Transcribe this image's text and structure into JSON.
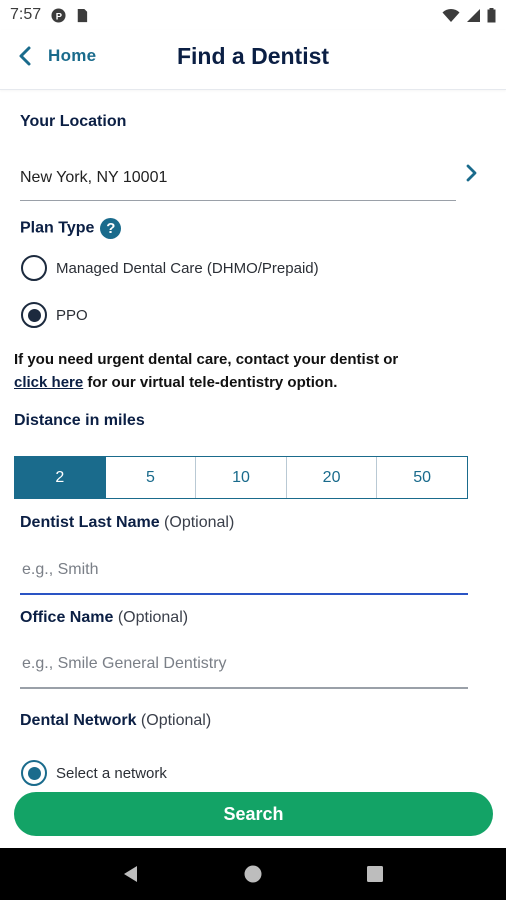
{
  "status_bar": {
    "time": "7:57",
    "left_icons": [
      "circle-p-icon",
      "sd-card-icon"
    ],
    "right_icons": [
      "wifi-icon",
      "signal-icon",
      "battery-icon"
    ]
  },
  "header": {
    "back_label": "Home",
    "title": "Find a Dentist"
  },
  "location": {
    "label": "Your Location",
    "value": "New York, NY 10001"
  },
  "plan_type": {
    "label": "Plan Type",
    "help_glyph": "?",
    "options": [
      {
        "label": "Managed Dental Care (DHMO/Prepaid)",
        "selected": false
      },
      {
        "label": "PPO",
        "selected": true
      }
    ]
  },
  "urgent": {
    "text_before": "If you need urgent dental care, contact your dentist or",
    "link": "click here",
    "text_after": "for our virtual tele-dentistry option."
  },
  "distance": {
    "label": "Distance in miles",
    "options": [
      "2",
      "5",
      "10",
      "20",
      "50"
    ],
    "selected": "2"
  },
  "dentist_last_name": {
    "label": "Dentist Last Name",
    "optional": "(Optional)",
    "placeholder": "e.g., Smith"
  },
  "office_name": {
    "label": "Office Name",
    "optional": "(Optional)",
    "placeholder": "e.g., Smile General Dentistry"
  },
  "dental_network": {
    "label": "Dental Network",
    "optional": "(Optional)",
    "option_label": "Select a network"
  },
  "search_button": "Search",
  "colors": {
    "primary_teal": "#1a6b8c",
    "navy_text": "#0b1f44",
    "search_green": "#13a366",
    "focus_blue": "#2a54c4"
  }
}
